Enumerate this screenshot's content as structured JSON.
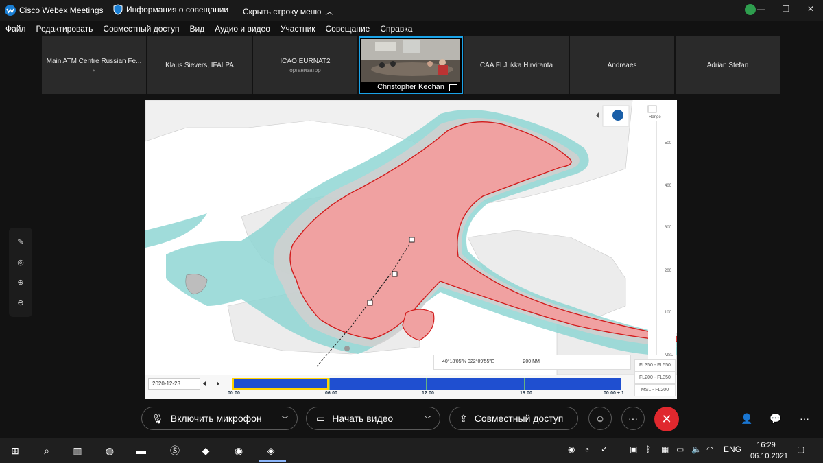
{
  "window": {
    "app_title": "Cisco Webex Meetings",
    "meeting_info": "Информация о совещании",
    "hide_menu": "Скрыть строку меню"
  },
  "menu": [
    "Файл",
    "Редактировать",
    "Совместный доступ",
    "Вид",
    "Аудио и видео",
    "Участник",
    "Совещание",
    "Справка"
  ],
  "participants": [
    {
      "name": "Main ATM Centre Russian Fe...",
      "sub": "я"
    },
    {
      "name": "Klaus Sievers, IFALPA",
      "sub": ""
    },
    {
      "name": "ICAO EURNAT2",
      "sub": "организатор"
    },
    {
      "name": "Christopher Keohan",
      "sub": ""
    },
    {
      "name": "CAA FI Jukka Hirviranta",
      "sub": ""
    },
    {
      "name": "Andreaes",
      "sub": ""
    },
    {
      "name": "Adrian Stefan",
      "sub": ""
    }
  ],
  "map": {
    "range_label": "Range",
    "altitude_ticks": [
      "500",
      "400",
      "300",
      "200",
      "100",
      "MSL"
    ],
    "coords_lat": "40°18'05\"N",
    "coords_lon": "022°09'55\"E",
    "scale_label": "200 NM",
    "flight_levels": [
      "FL350 - FL550",
      "FL200 - FL350",
      "MSL - FL200"
    ],
    "timeline": {
      "date": "2020-12-23",
      "ticks": [
        "00:00",
        "06:00",
        "12:00",
        "18:00",
        "00:00 + 1"
      ]
    },
    "fill_colors": {
      "cyan": "#8fd6d3",
      "red_zone": "#f0a1a1",
      "red_border": "#d21c1c",
      "land": "#f0f0f0",
      "sea": "#ffffff"
    }
  },
  "controls": {
    "mic": "Включить микрофон",
    "video": "Начать видео",
    "share": "Совместный доступ"
  },
  "taskbar": {
    "lang": "ENG",
    "time": "16:29",
    "date": "06.10.2021"
  }
}
